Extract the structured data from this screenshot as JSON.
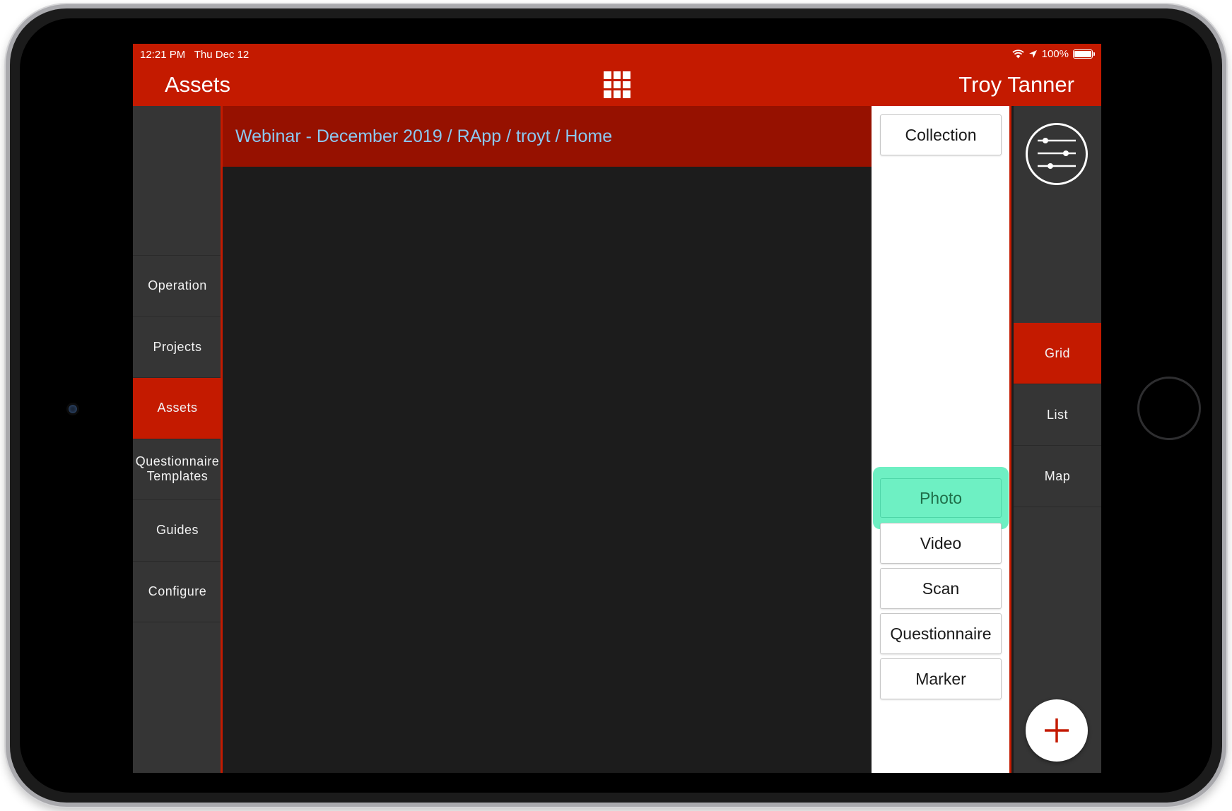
{
  "status_bar": {
    "time": "12:21 PM",
    "date": "Thu Dec 12",
    "battery": "100%"
  },
  "header": {
    "title": "Assets",
    "user": "Troy Tanner",
    "menu_icon": "grid-icon"
  },
  "breadcrumb": {
    "path": "Webinar - December 2019 / RApp / troyt / Home"
  },
  "sidebar": {
    "items": [
      {
        "label": "Operation",
        "active": false
      },
      {
        "label": "Projects",
        "active": false
      },
      {
        "label": "Assets",
        "active": true
      },
      {
        "label": "Questionnaire Templates",
        "active": false
      },
      {
        "label": "Guides",
        "active": false
      },
      {
        "label": "Configure",
        "active": false
      }
    ]
  },
  "type_panel": {
    "collection": "Collection",
    "photo": "Photo",
    "video": "Video",
    "scan": "Scan",
    "questionnaire": "Questionnaire",
    "marker": "Marker"
  },
  "view_modes": {
    "grid": "Grid",
    "list": "List",
    "map": "Map",
    "selected": "Grid"
  },
  "icons": {
    "filter": "sliders-icon",
    "add": "plus-icon",
    "wifi": "wifi-icon",
    "location": "location-arrow-icon",
    "battery": "battery-icon"
  },
  "colors": {
    "brand_red": "#c41a00",
    "breadcrumb_bg": "#961100",
    "breadcrumb_text": "#8cc8ef",
    "highlight": "#6ef0c3",
    "dark_panel": "#353535"
  }
}
